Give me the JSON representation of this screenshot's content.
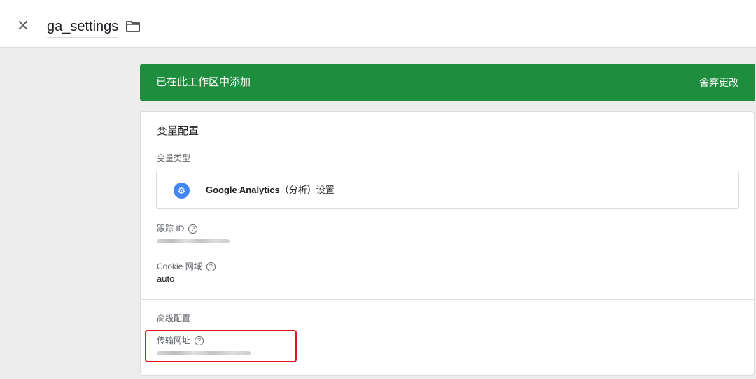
{
  "header": {
    "close_glyph": "✕",
    "title": "ga_settings",
    "folder_icon": "folder-icon"
  },
  "banner": {
    "text": "已在此工作区中添加",
    "discard_label": "舍弃更改",
    "color": "#1e8e3e"
  },
  "card": {
    "title": "变量配置",
    "variable_type_label": "变量类型",
    "variable_type": {
      "icon": "gear-icon",
      "name": "Google Analytics",
      "suffix": "（分析）设置"
    },
    "fields": [
      {
        "label": "跟踪 ID",
        "help_glyph": "?",
        "value": ""
      },
      {
        "label": "Cookie 网域",
        "help_glyph": "?",
        "value": "auto"
      }
    ],
    "advanced": {
      "title": "高级配置",
      "field_label": "传输网址",
      "help_glyph": "?",
      "value": ""
    }
  },
  "annotation": {
    "color": "#e5131b"
  }
}
